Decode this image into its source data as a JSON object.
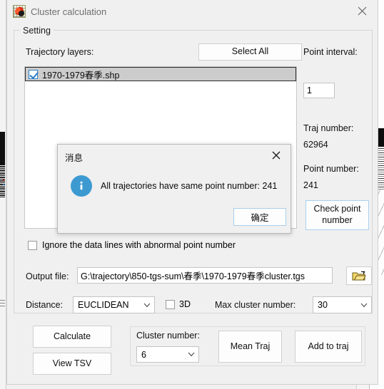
{
  "window": {
    "title": "Cluster calculation",
    "icon": "app-grid-icon",
    "close_icon": "close-icon"
  },
  "setting_group": {
    "label": "Setting"
  },
  "trajectory": {
    "label": "Trajectory layers:",
    "select_all_label": "Select All",
    "items": [
      {
        "label": "1970-1979春季.shp",
        "checked": true,
        "selected": true
      }
    ]
  },
  "info_column": {
    "point_interval_label": "Point interval:",
    "point_interval_value": "1",
    "traj_number_label": "Traj number:",
    "traj_number_value": "62964",
    "point_number_label": "Point number:",
    "point_number_value": "241",
    "check_point_number_label_line1": "Check point",
    "check_point_number_label_line2": "number"
  },
  "ignore_abnormal": {
    "label": "Ignore the data lines with abnormal point number",
    "checked": false
  },
  "output": {
    "label": "Output file:",
    "value": "G:\\trajectory\\850-tgs-sum\\春季\\1970-1979春季cluster.tgs",
    "placeholder": "",
    "browse_icon": "folder-open-icon"
  },
  "distance": {
    "label": "Distance:",
    "selected": "EUCLIDEAN",
    "options": [
      "EUCLIDEAN"
    ],
    "three_d_label": "3D",
    "three_d_checked": false,
    "max_cluster_label": "Max cluster number:",
    "max_cluster_selected": "30",
    "max_cluster_options": [
      "30"
    ]
  },
  "actions": {
    "calculate_label": "Calculate",
    "view_tsv_label": "View TSV",
    "cluster_number_label": "Cluster number:",
    "cluster_number_selected": "6",
    "cluster_number_options": [
      "6"
    ],
    "mean_traj_label": "Mean Traj",
    "add_to_traj_label": "Add to traj"
  },
  "message_dialog": {
    "title": "消息",
    "icon": "info-icon",
    "text": "All trajectories have same point number: 241",
    "ok_label": "确定",
    "close_icon": "close-icon"
  },
  "colors": {
    "dialog_background": "#f0f0f0",
    "field_background": "#ffffff",
    "info_icon_blue": "#3d9ad1",
    "focus_border_blue": "#a8cfec",
    "checkbox_blue": "#2a7fc9",
    "selection_gray": "#cccccc",
    "title_text_gray": "#6f6f6f",
    "folder_icon_yellow": "#e8c84a"
  }
}
